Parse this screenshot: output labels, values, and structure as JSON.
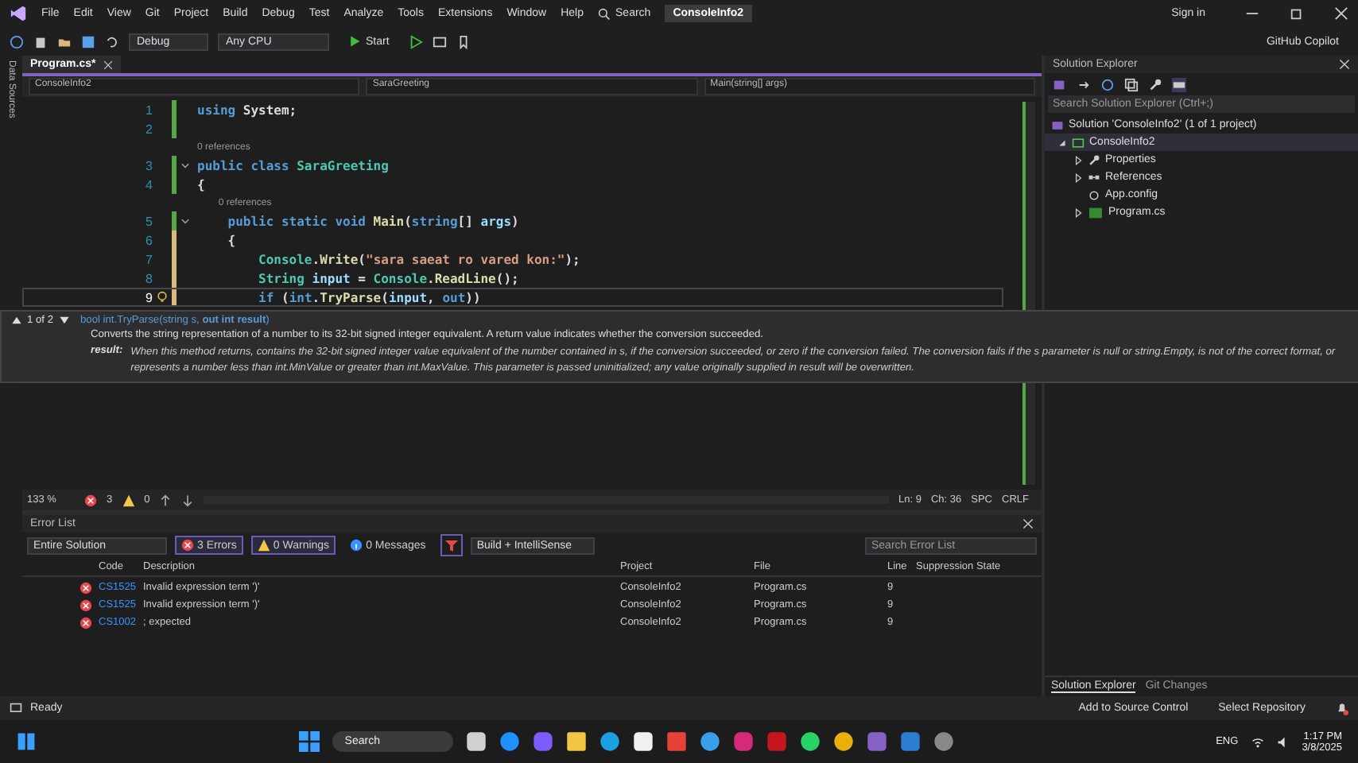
{
  "menu_bar": {
    "items": [
      "File",
      "Edit",
      "View",
      "Git",
      "Project",
      "Build",
      "Debug",
      "Test",
      "Analyze",
      "Tools",
      "Extensions",
      "Window",
      "Help"
    ],
    "search": "Search",
    "solution_name": "ConsoleInfo2",
    "sign_in": "Sign in"
  },
  "toolbar": {
    "configuration": "Debug",
    "platform": "Any CPU",
    "start": "Start",
    "copilot": "GitHub Copilot"
  },
  "side_strip": {
    "label": "Data Sources"
  },
  "editor": {
    "tabs": [
      {
        "label": "Program.cs*",
        "selected": true
      }
    ],
    "nav": [
      "ConsoleInfo2",
      "SaraGreeting",
      "Main(string[] args)"
    ],
    "lines": [
      {
        "number": "1",
        "saved": true,
        "fold": false,
        "current": false,
        "lightbulb": false,
        "tokens": [
          {
            "kind": "keyword",
            "text": "using"
          },
          {
            "kind": "plain",
            "text": " System;"
          }
        ]
      },
      {
        "number": "2",
        "saved": true,
        "fold": false,
        "current": false,
        "lightbulb": false
      },
      {
        "number": "3",
        "saved": true,
        "fold": true,
        "current": false,
        "lightbulb": false,
        "codelens": "0 references",
        "tokens": [
          {
            "kind": "keyword",
            "text": "public class"
          },
          {
            "kind": "type",
            "text": " SaraGreeting"
          }
        ]
      },
      {
        "number": "4",
        "saved": true,
        "fold": false,
        "current": false,
        "lightbulb": false,
        "tokens": [
          {
            "kind": "plain",
            "text": "{"
          }
        ],
        "children": [
          {
            "number": "5",
            "saved": true,
            "fold": true,
            "current": false,
            "lightbulb": false,
            "codelens": "0 references",
            "tokens": [
              {
                "kind": "keyword",
                "text": "public static void"
              },
              {
                "kind": "method",
                "text": " Main"
              },
              {
                "kind": "plain",
                "text": "("
              },
              {
                "kind": "keyword",
                "text": "string"
              },
              {
                "kind": "plain",
                "text": "[] "
              },
              {
                "kind": "param",
                "text": "args"
              },
              {
                "kind": "plain",
                "text": ")"
              }
            ]
          },
          {
            "number": "6",
            "saved": false,
            "fold": false,
            "current": false,
            "lightbulb": false,
            "tokens": [
              {
                "kind": "plain",
                "text": "{"
              }
            ],
            "children": [
              {
                "number": "7",
                "saved": false,
                "fold": false,
                "current": false,
                "lightbulb": false,
                "tokens": [
                  {
                    "kind": "type",
                    "text": "Console"
                  },
                  {
                    "kind": "plain",
                    "text": "."
                  },
                  {
                    "kind": "method",
                    "text": "Write"
                  },
                  {
                    "kind": "plain",
                    "text": "("
                  },
                  {
                    "kind": "string",
                    "text": "\"sara saeat ro vared kon:\""
                  },
                  {
                    "kind": "plain",
                    "text": ");"
                  }
                ]
              },
              {
                "number": "8",
                "saved": false,
                "fold": false,
                "current": false,
                "lightbulb": false,
                "tokens": [
                  {
                    "kind": "type",
                    "text": "String"
                  },
                  {
                    "kind": "param",
                    "text": " input"
                  },
                  {
                    "kind": "plain",
                    "text": " = "
                  },
                  {
                    "kind": "type",
                    "text": "Console"
                  },
                  {
                    "kind": "plain",
                    "text": "."
                  },
                  {
                    "kind": "method",
                    "text": "ReadLine"
                  },
                  {
                    "kind": "plain",
                    "text": "();"
                  }
                ]
              },
              {
                "number": "9",
                "saved": false,
                "fold": false,
                "current": true,
                "lightbulb": true,
                "tokens": [
                  {
                    "kind": "keyword",
                    "text": "if"
                  },
                  {
                    "kind": "plain",
                    "text": " ("
                  },
                  {
                    "kind": "keyword",
                    "text": "int"
                  },
                  {
                    "kind": "plain",
                    "text": "."
                  },
                  {
                    "kind": "method",
                    "text": "TryParse"
                  },
                  {
                    "kind": "plain",
                    "text": "("
                  },
                  {
                    "kind": "param",
                    "text": "input"
                  },
                  {
                    "kind": "plain",
                    "text": ", "
                  },
                  {
                    "kind": "keyword",
                    "text": "out"
                  },
                  {
                    "kind": "plain",
                    "text": "))"
                  }
                ]
              }
            ]
          }
        ]
      }
    ],
    "tooltip": {
      "overload": "1 of 2",
      "signature": "bool int.TryParse(string s, **out int result**)",
      "summary": "Converts the string representation of a number to its 32-bit signed integer equivalent. A return value indicates whether the conversion succeeded.",
      "param_name": "result:",
      "param_text": "When this method returns, contains the 32-bit signed integer value equivalent of the number contained in s, if the conversion succeeded, or zero if the conversion failed. The conversion fails if the s parameter is null or string.Empty, is not of the correct format, or represents a number less than int.MinValue or greater than int.MaxValue. This parameter is passed uninitialized; any value originally supplied in result will be overwritten."
    },
    "status": {
      "zoom": "133 %",
      "errors": "3",
      "warnings": "0",
      "line": "Ln: 9",
      "column": "Ch: 36",
      "indent": "SPC",
      "line_ending": "CRLF"
    }
  },
  "error_list": {
    "title": "Error List",
    "scope": "Entire Solution",
    "filters": [
      {
        "kind": "error",
        "label": "3 Errors",
        "selected": true
      },
      {
        "kind": "warning",
        "label": "0 Warnings",
        "selected": true
      },
      {
        "kind": "message",
        "label": "0 Messages",
        "selected": false
      }
    ],
    "source": "Build + IntelliSense",
    "search_placeholder": "Search Error List",
    "columns": [
      "Code",
      "Description",
      "Project",
      "File",
      "Line",
      "Suppression State"
    ],
    "rows": [
      {
        "kind": "error",
        "code": "CS1525",
        "description": "Invalid expression term ')'",
        "project": "ConsoleInfo2",
        "file": "Program.cs",
        "line": "9"
      },
      {
        "kind": "error",
        "code": "CS1525",
        "description": "Invalid expression term ')'",
        "project": "ConsoleInfo2",
        "file": "Program.cs",
        "line": "9"
      },
      {
        "kind": "error",
        "code": "CS1002",
        "description": "; expected",
        "project": "ConsoleInfo2",
        "file": "Program.cs",
        "line": "9"
      }
    ]
  },
  "solution_explorer": {
    "title": "Solution Explorer",
    "search_placeholder": "Search Solution Explorer (Ctrl+;)",
    "tree": [
      {
        "label": "Solution 'ConsoleInfo2' (1 of 1 project)",
        "selected": false,
        "children": [
          {
            "label": "ConsoleInfo2",
            "selected": true,
            "expanded": true,
            "children": [
              {
                "label": "Properties",
                "kind": "wrench",
                "selected": false,
                "expanded": false
              },
              {
                "label": "References",
                "kind": "references",
                "selected": false,
                "expanded": false
              },
              {
                "label": "App.config",
                "kind": "config",
                "selected": false
              },
              {
                "label": "Program.cs",
                "kind": "csharp",
                "selected": false,
                "expanded": false
              }
            ]
          }
        ]
      }
    ],
    "tabs": [
      {
        "label": "Solution Explorer",
        "selected": true
      },
      {
        "label": "Git Changes",
        "selected": false
      }
    ]
  },
  "status_bar": {
    "text": "Ready",
    "source_control": "Add to Source Control",
    "repository": "Select Repository"
  },
  "taskbar": {
    "search": "Search",
    "language": "ENG",
    "time": "1:17 PM",
    "date": "3/8/2025"
  }
}
